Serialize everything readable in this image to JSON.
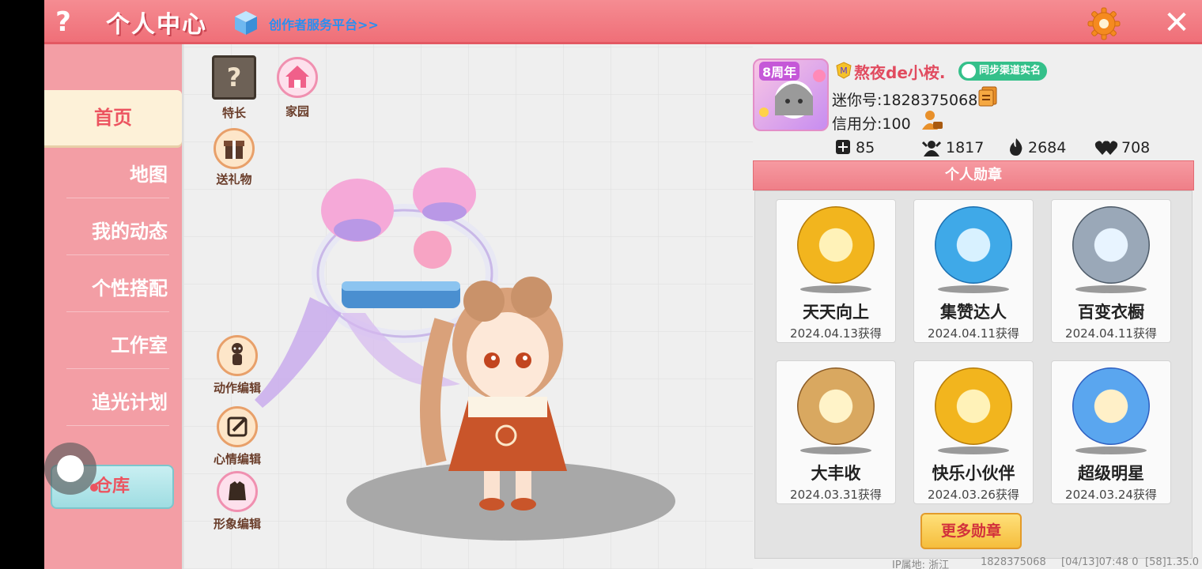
{
  "header": {
    "help_label": "?",
    "title": "个人中心",
    "creator_link": "创作者服务平台>>",
    "close_label": "✕"
  },
  "sidebar": {
    "items": [
      {
        "label": "首页",
        "active": true
      },
      {
        "label": "地图"
      },
      {
        "label": "我的动态"
      },
      {
        "label": "个性搭配"
      },
      {
        "label": "工作室"
      },
      {
        "label": "追光计划"
      }
    ],
    "warehouse_label": "仓库"
  },
  "center": {
    "icons": {
      "talent": "特长",
      "home": "家园",
      "gift": "送礼物",
      "action_edit": "动作编辑",
      "mood_edit": "心情编辑",
      "image_edit": "形象编辑"
    },
    "talent_glyph": "?"
  },
  "profile": {
    "anniversary_badge": "8周年",
    "name": "熬夜de小桉.",
    "verify_badge": "同步渠道实名",
    "mini_id": "迷你号:1828375068",
    "credit": "信用分:100",
    "stats": {
      "stat1": "85",
      "stat2": "1817",
      "stat3": "2684",
      "stat4": "708"
    }
  },
  "medals": {
    "header": "个人勋章",
    "items": [
      {
        "name": "天天向上",
        "date": "2024.04.13获得",
        "color": "#f2b51e"
      },
      {
        "name": "集赞达人",
        "date": "2024.04.11获得",
        "color": "#3fa9e8"
      },
      {
        "name": "百变衣橱",
        "date": "2024.04.11获得",
        "color": "#7f8c9a"
      },
      {
        "name": "大丰收",
        "date": "2024.03.31获得",
        "color": "#b8874a"
      },
      {
        "name": "快乐小伙伴",
        "date": "2024.03.26获得",
        "color": "#f2b51e"
      },
      {
        "name": "超级明星",
        "date": "2024.03.24获得",
        "color": "#5aa6ef"
      }
    ],
    "more_label": "更多勋章"
  },
  "footer": {
    "ip": "IP属地: 浙江",
    "uid": "1828375068",
    "time": "[04/13]07:48 0",
    "version": "[58]1.35.0"
  },
  "colors": {
    "brand_pink": "#ef6f78",
    "active_tab_bg": "#fdf1d8",
    "accent_red": "#ec5460",
    "link_blue": "#2a8ff0"
  }
}
